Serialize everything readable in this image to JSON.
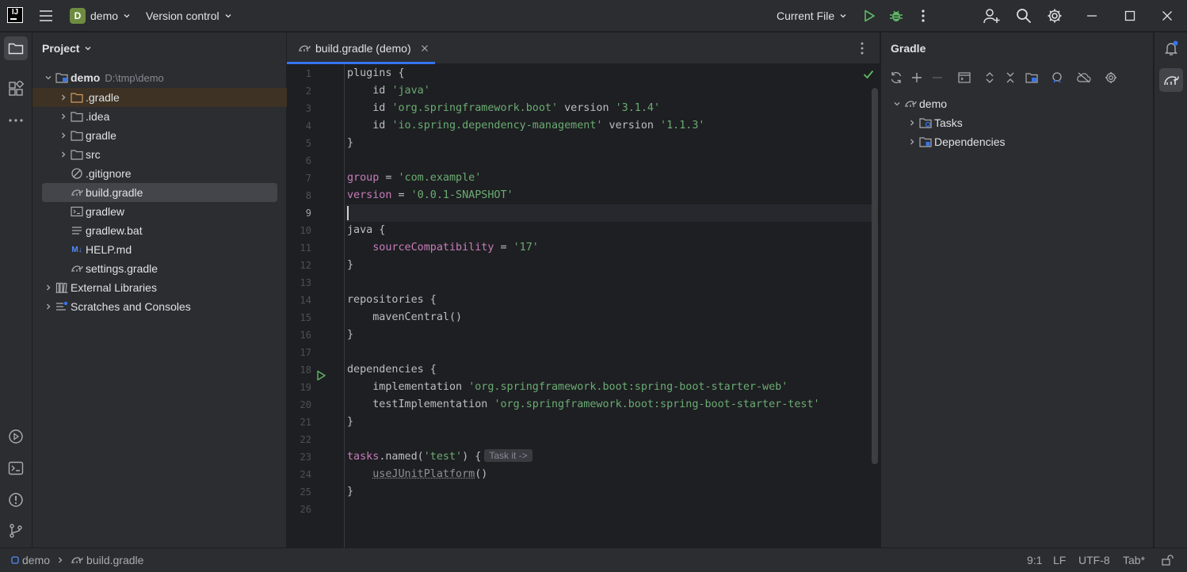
{
  "titlebar": {
    "project_badge": "D",
    "project_name": "demo",
    "vcs_label": "Version control",
    "run_config": "Current File",
    "icons": [
      "app-logo-icon",
      "hamburger-menu-icon",
      "run-icon",
      "debug-icon",
      "more-vertical-icon",
      "add-user-icon",
      "search-icon",
      "settings-icon",
      "minimize-icon",
      "maximize-icon",
      "close-icon"
    ]
  },
  "project_panel": {
    "title": "Project",
    "root": {
      "name": "demo",
      "path": "D:\\tmp\\demo"
    },
    "items": [
      {
        "name": ".gradle",
        "type": "folder"
      },
      {
        "name": ".idea",
        "type": "folder"
      },
      {
        "name": "gradle",
        "type": "folder"
      },
      {
        "name": "src",
        "type": "folder"
      },
      {
        "name": ".gitignore",
        "type": "ignore-file"
      },
      {
        "name": "build.gradle",
        "type": "gradle-file"
      },
      {
        "name": "gradlew",
        "type": "shell-file"
      },
      {
        "name": "gradlew.bat",
        "type": "text-file"
      },
      {
        "name": "HELP.md",
        "type": "markdown-file",
        "badge": "M↓"
      },
      {
        "name": "settings.gradle",
        "type": "gradle-file"
      }
    ],
    "external_libraries": "External Libraries",
    "scratches": "Scratches and Consoles"
  },
  "editor": {
    "tab_label": "build.gradle (demo)",
    "current_line": 9,
    "line_numbers": [
      "1",
      "2",
      "3",
      "4",
      "5",
      "6",
      "7",
      "8",
      "9",
      "10",
      "11",
      "12",
      "13",
      "14",
      "15",
      "16",
      "17",
      "18",
      "19",
      "20",
      "21",
      "22",
      "23",
      "24",
      "25",
      "26"
    ],
    "lines": {
      "l1": "plugins {",
      "l2_kw": "    id ",
      "l2_s": "'java'",
      "l3_kw": "    id ",
      "l3_s": "'org.springframework.boot'",
      "l3_kw2": " version ",
      "l3_s2": "'3.1.4'",
      "l4_kw": "    id ",
      "l4_s": "'io.spring.dependency-management'",
      "l4_kw2": " version ",
      "l4_s2": "'1.1.3'",
      "l5": "}",
      "l7_p": "group",
      "l7_eq": " = ",
      "l7_s": "'com.example'",
      "l8_p": "version",
      "l8_eq": " = ",
      "l8_s": "'0.0.1-SNAPSHOT'",
      "l10": "java {",
      "l11_p": "    sourceCompatibility",
      "l11_eq": " = ",
      "l11_s": "'17'",
      "l12": "}",
      "l14": "repositories {",
      "l15": "    mavenCentral()",
      "l16": "}",
      "l18": "dependencies {",
      "l19_kw": "    implementation ",
      "l19_s": "'org.springframework.boot:spring-boot-starter-web'",
      "l20_kw": "    testImplementation ",
      "l20_s": "'org.springframework.boot:spring-boot-starter-test'",
      "l21": "}",
      "l23_p": "tasks",
      "l23_a": ".named(",
      "l23_s": "'test'",
      "l23_b": ") {",
      "l23_hint": "Task it ->",
      "l24_pre": "    ",
      "l24_fn": "useJUnitPlatform",
      "l24_post": "()",
      "l25": "}"
    }
  },
  "gradle_panel": {
    "title": "Gradle",
    "tree": {
      "root": "demo",
      "children": [
        "Tasks",
        "Dependencies"
      ]
    },
    "toolbar_icons": [
      "reload-icon",
      "add-icon",
      "remove-icon",
      "execute-task-icon",
      "expand-all-icon",
      "collapse-all-icon",
      "dependencies-icon",
      "analyze-icon",
      "offline-mode-icon",
      "gradle-settings-icon"
    ]
  },
  "statusbar": {
    "breadcrumb_project": "demo",
    "breadcrumb_file": "build.gradle",
    "position": "9:1",
    "line_separator": "LF",
    "encoding": "UTF-8",
    "indent": "Tab*"
  },
  "colors": {
    "background": "#1e1f22",
    "panel": "#2b2d30",
    "accent": "#3574f0",
    "string": "#6aab73",
    "property": "#c77dbb",
    "run_green": "#5fb865"
  }
}
